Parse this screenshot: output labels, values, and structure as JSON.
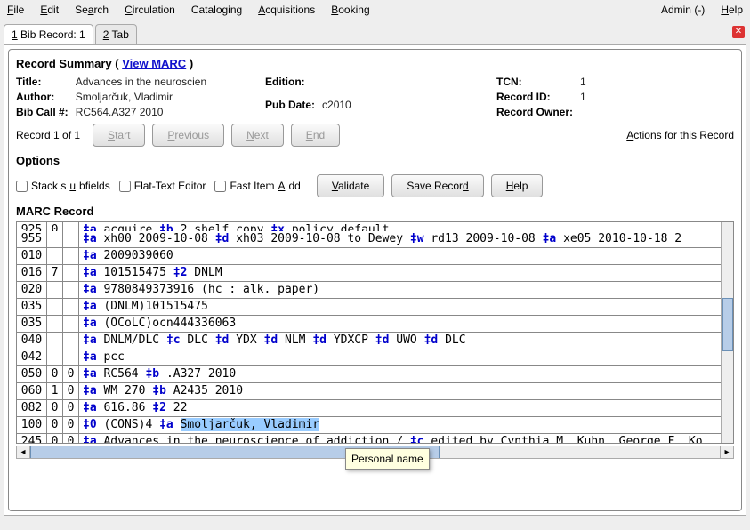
{
  "menu": {
    "file": "File",
    "edit": "Edit",
    "search": "Search",
    "circulation": "Circulation",
    "cataloging": "Cataloging",
    "acquisitions": "Acquisitions",
    "booking": "Booking",
    "admin": "Admin (-)",
    "help": "Help"
  },
  "tabs": {
    "t1": "1 Bib Record: 1",
    "t2": "2 Tab"
  },
  "summary": {
    "head_prefix": "Record Summary ( ",
    "view_marc": "View MARC",
    "head_suffix": " )",
    "title_lbl": "Title:",
    "title_val": "Advances in the neuroscien",
    "author_lbl": "Author:",
    "author_val": "Smoljarčuk, Vladimir",
    "call_lbl": "Bib Call #:",
    "call_val": "RC564.A327 2010",
    "edition_lbl": "Edition:",
    "edition_val": "",
    "pubdate_lbl": "Pub Date:",
    "pubdate_val": "c2010",
    "tcn_lbl": "TCN:",
    "tcn_val": "1",
    "recid_lbl": "Record ID:",
    "recid_val": "1",
    "owner_lbl": "Record Owner:",
    "owner_val": ""
  },
  "nav": {
    "info": "Record 1 of 1",
    "start": "Start",
    "prev": "Previous",
    "next": "Next",
    "end": "End",
    "actions": "Actions for this Record"
  },
  "options": {
    "heading": "Options",
    "stack": "Stack subfields",
    "flat": "Flat-Text Editor",
    "fast": "Fast Item Add",
    "validate": "Validate",
    "save": "Save Record",
    "help": "Help"
  },
  "marc": {
    "heading": "MARC Record",
    "tooltip": "Personal name",
    "rows": [
      {
        "tag": "925",
        "i1": "0",
        "i2": "",
        "sf": [
          [
            "a",
            "acquire"
          ],
          [
            "b",
            "2 shelf copy"
          ],
          [
            "x",
            "policy default"
          ]
        ]
      },
      {
        "tag": "955",
        "i1": "",
        "i2": "",
        "sf": [
          [
            "a",
            "xh00 2009-10-08"
          ],
          [
            "d",
            "xh03 2009-10-08 to Dewey"
          ],
          [
            "w",
            "rd13 2009-10-08"
          ],
          [
            "a",
            "xe05 2010-10-18 2"
          ]
        ]
      },
      {
        "tag": "010",
        "i1": "",
        "i2": "",
        "sf": [
          [
            "a",
            "2009039060"
          ]
        ]
      },
      {
        "tag": "016",
        "i1": "7",
        "i2": "",
        "sf": [
          [
            "a",
            "101515475"
          ],
          [
            "2",
            "DNLM"
          ]
        ]
      },
      {
        "tag": "020",
        "i1": "",
        "i2": "",
        "sf": [
          [
            "a",
            "9780849373916 (hc : alk. paper)"
          ]
        ]
      },
      {
        "tag": "035",
        "i1": "",
        "i2": "",
        "sf": [
          [
            "a",
            "(DNLM)101515475"
          ]
        ]
      },
      {
        "tag": "035",
        "i1": "",
        "i2": "",
        "sf": [
          [
            "a",
            "(OCoLC)ocn444336063"
          ]
        ]
      },
      {
        "tag": "040",
        "i1": "",
        "i2": "",
        "sf": [
          [
            "a",
            "DNLM/DLC"
          ],
          [
            "c",
            "DLC"
          ],
          [
            "d",
            "YDX"
          ],
          [
            "d",
            "NLM"
          ],
          [
            "d",
            "YDXCP"
          ],
          [
            "d",
            "UWO"
          ],
          [
            "d",
            "DLC"
          ]
        ]
      },
      {
        "tag": "042",
        "i1": "",
        "i2": "",
        "sf": [
          [
            "a",
            "pcc"
          ]
        ]
      },
      {
        "tag": "050",
        "i1": "0",
        "i2": "0",
        "sf": [
          [
            "a",
            "RC564"
          ],
          [
            "b",
            ".A327 2010"
          ]
        ]
      },
      {
        "tag": "060",
        "i1": "1",
        "i2": "0",
        "sf": [
          [
            "a",
            "WM 270"
          ],
          [
            "b",
            "A2435 2010"
          ]
        ]
      },
      {
        "tag": "082",
        "i1": "0",
        "i2": "0",
        "sf": [
          [
            "a",
            "616.86"
          ],
          [
            "2",
            "22"
          ]
        ]
      },
      {
        "tag": "100",
        "i1": "0",
        "i2": "0",
        "sf": [
          [
            "0",
            "(CONS)4"
          ],
          [
            "a",
            "Smoljarčuk, Vladimir"
          ]
        ],
        "hl": 1
      },
      {
        "tag": "245",
        "i1": "0",
        "i2": "0",
        "sf": [
          [
            "a",
            "Advances in the neuroscience of addiction /"
          ],
          [
            "c",
            "edited by Cynthia M. Kuhn, George F. Ko"
          ]
        ]
      }
    ]
  }
}
